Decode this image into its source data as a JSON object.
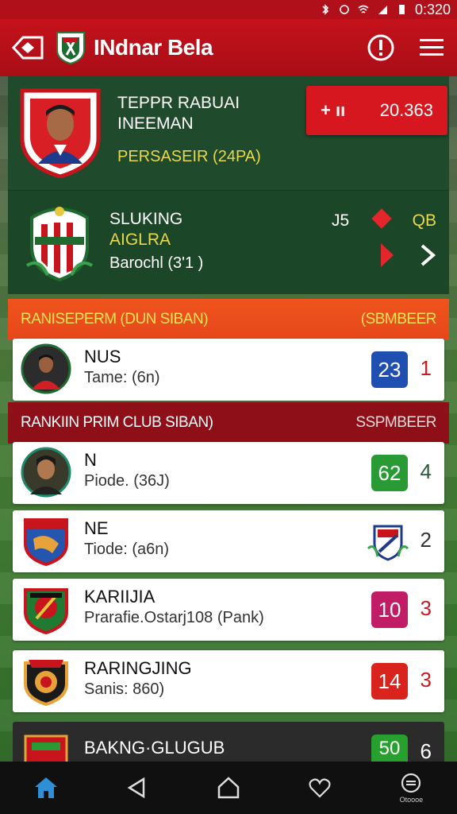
{
  "status_bar": {
    "time": "0:320"
  },
  "app_bar": {
    "title": "INdnar Bela"
  },
  "player_card": {
    "name_line1": "TEPPR RABUAI",
    "name_line2": "INEEMAN",
    "club": "PERSASEIR (24PA)",
    "score_prefix": "+ ıı",
    "score_value": "20.363"
  },
  "club_card": {
    "line1": "SLUKING",
    "line2": "AIGLRA",
    "line3": "Barochl  (3'1 )",
    "stat_left": "J5",
    "stat_right": "QB"
  },
  "section1": {
    "title": "RANISEPERM (DUN SIBAN)",
    "right": "(SBMBEER"
  },
  "section2": {
    "title": "RANKIIN PRIM CLUB SIBAN)",
    "right": "SSPMBEER"
  },
  "rows_top": [
    {
      "title": "NUS",
      "subtitle": "Tame: (6n)",
      "badge": "23",
      "badge_color": "#1f4fb0",
      "rank": "1",
      "rank_color": "#c41c24"
    }
  ],
  "rows_main": [
    {
      "title": "N",
      "subtitle": "Piode. (36J)",
      "badge": "62",
      "badge_color": "#2a9a34",
      "rank": "4",
      "rank_color": "#2a5a3a",
      "type": "pill"
    },
    {
      "title": "NE",
      "subtitle": "Tiode: (a6n)",
      "badge": "",
      "rank": "2",
      "rank_color": "#333333",
      "type": "crest"
    },
    {
      "title": "KARIIJIA",
      "subtitle": "Prarafie.Ostarj108 (Pank)",
      "badge": "10",
      "badge_color": "#c01d66",
      "rank": "3",
      "rank_color": "#c41c24",
      "type": "pill"
    },
    {
      "title": "RARINGJING",
      "subtitle": "Sanis: 860)",
      "badge": "14",
      "badge_color": "#d8241c",
      "rank": "3",
      "rank_color": "#c41c24",
      "type": "pill"
    }
  ],
  "row_partial": {
    "title": "BAKNG·GLUGUB",
    "badge": "50",
    "rank": "6"
  },
  "nav": {
    "last_label": "Otoooe"
  }
}
